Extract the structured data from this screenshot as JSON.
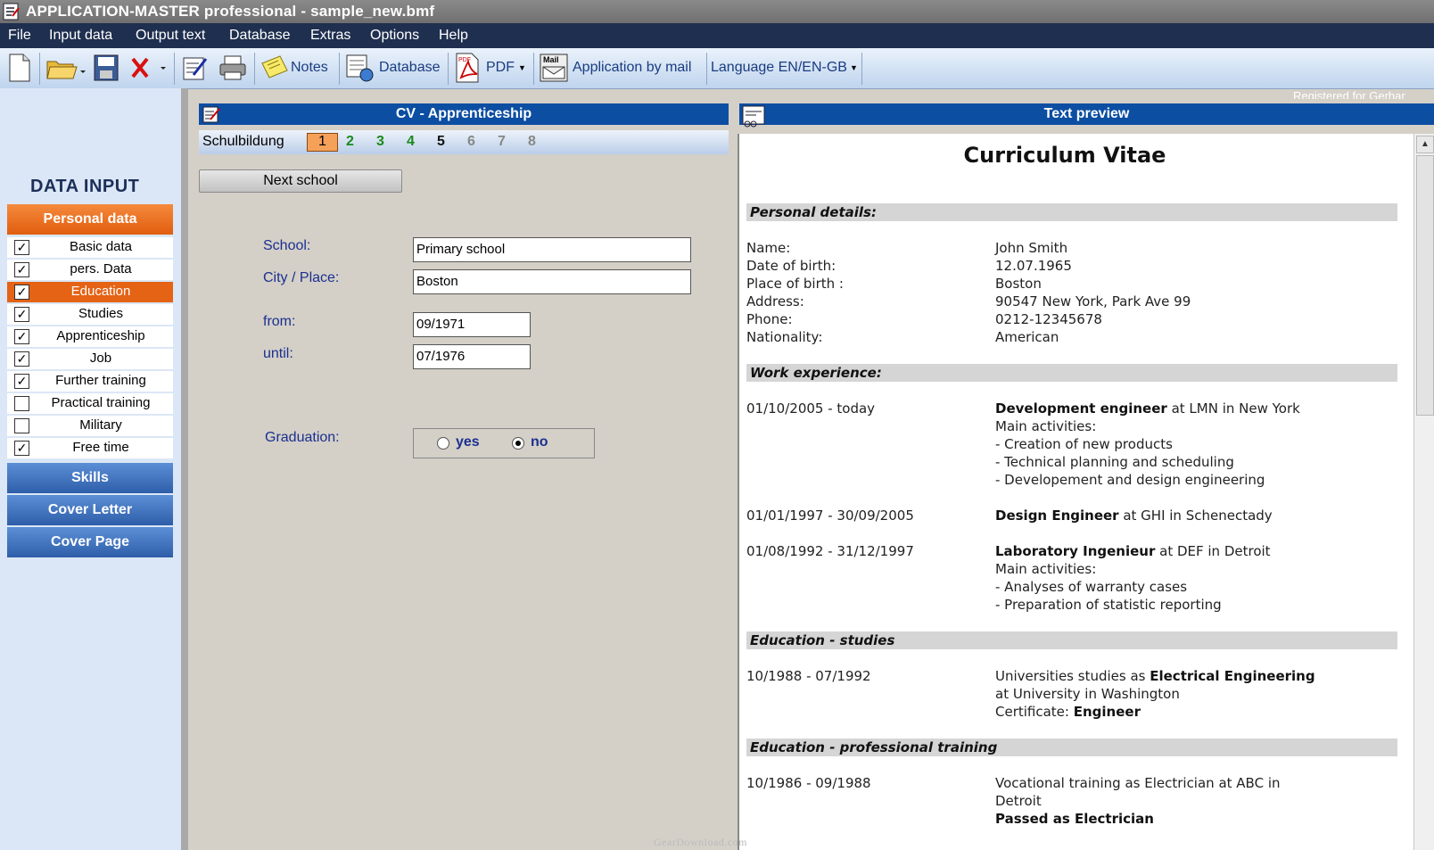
{
  "window": {
    "title": "APPLICATION-MASTER professional - sample_new.bmf"
  },
  "menu": [
    "File",
    "Input data",
    "Output text",
    "Database",
    "Extras",
    "Options",
    "Help"
  ],
  "toolbar": {
    "notes_label": "Notes",
    "database_label": "Database",
    "pdf_label": "PDF",
    "mail_label": "Application by mail",
    "language_label": "Language EN/EN-GB",
    "registered_text": "Registered for Gerhar",
    "icons": [
      "new-document-icon",
      "open-folder-icon",
      "save-icon",
      "delete-icon",
      "edit-icon",
      "print-icon",
      "notes-icon",
      "database-icon",
      "pdf-icon",
      "mail-icon"
    ]
  },
  "sidebar": {
    "title": "DATA INPUT",
    "personal_header": "Personal data",
    "items": [
      {
        "label": "Basic data",
        "checked": true,
        "active": false
      },
      {
        "label": "pers. Data",
        "checked": true,
        "active": false
      },
      {
        "label": "Education",
        "checked": true,
        "active": true
      },
      {
        "label": "Studies",
        "checked": true,
        "active": false
      },
      {
        "label": "Apprenticeship",
        "checked": true,
        "active": false
      },
      {
        "label": "Job",
        "checked": true,
        "active": false
      },
      {
        "label": "Further training",
        "checked": true,
        "active": false
      },
      {
        "label": "Practical training",
        "checked": false,
        "active": false
      },
      {
        "label": "Military",
        "checked": false,
        "active": false
      },
      {
        "label": "Free time",
        "checked": true,
        "active": false
      }
    ],
    "skills_header": "Skills",
    "cover_letter_header": "Cover Letter",
    "cover_page_header": "Cover Page"
  },
  "form": {
    "header": "CV - Apprenticeship",
    "tab_label": "Schulbildung",
    "tabs": [
      "1",
      "2",
      "3",
      "4",
      "5",
      "6",
      "7",
      "8"
    ],
    "active_tab": "1",
    "next_button": "Next school",
    "school_label": "School:",
    "school_value": "Primary school",
    "city_label": "City / Place:",
    "city_value": "Boston",
    "from_label": "from:",
    "from_value": "09/1971",
    "until_label": "until:",
    "until_value": "07/1976",
    "graduation_label": "Graduation:",
    "yes_label": "yes",
    "no_label": "no",
    "graduation_selected": "no"
  },
  "preview": {
    "header": "Text preview",
    "doc_title": "Curriculum Vitae",
    "personal_heading": "Personal details:",
    "personal": [
      {
        "label": "Name:",
        "value": "John Smith"
      },
      {
        "label": "Date of birth:",
        "value": "12.07.1965"
      },
      {
        "label": "Place of birth :",
        "value": "Boston"
      },
      {
        "label": "Address:",
        "value": "90547 New York, Park Ave 99"
      },
      {
        "label": "Phone:",
        "value": "0212-12345678"
      },
      {
        "label": "Nationality:",
        "value": "American"
      }
    ],
    "work_heading": "Work experience:",
    "work": [
      {
        "period": "01/10/2005 - today",
        "title": "Development engineer",
        "rest": " at LMN in New York",
        "lines": [
          "Main activities:",
          "- Creation of new products",
          "- Technical planning and scheduling",
          "- Developement and design engineering"
        ]
      },
      {
        "period": "01/01/1997 - 30/09/2005",
        "title": "Design Engineer",
        "rest": " at GHI in Schenectady",
        "lines": []
      },
      {
        "period": "01/08/1992 - 31/12/1997",
        "title": "Laboratory Ingenieur",
        "rest": " at DEF in Detroit",
        "lines": [
          "Main activities:",
          "- Analyses of warranty cases",
          "- Preparation of statistic reporting"
        ]
      }
    ],
    "studies_heading": "Education - studies",
    "studies": {
      "period": "10/1988 - 07/1992",
      "line1_prefix": "Universities studies as ",
      "line1_bold": "Electrical Engineering",
      "line2": "at University in Washington",
      "line3_prefix": "Certificate: ",
      "line3_bold": "Engineer"
    },
    "training_heading": "Education - professional training",
    "training": {
      "period": "10/1986 - 09/1988",
      "line1": "Vocational training as Electrician at ABC in",
      "line2": "Detroit",
      "line3_bold": "Passed as Electrician"
    }
  },
  "watermark": "GearDownload.com",
  "colors": {
    "accent_orange": "#e56315",
    "header_blue": "#0c4ea2",
    "menu_bg": "#1f2f4f",
    "sidebar_bg": "#dbe7f6"
  }
}
